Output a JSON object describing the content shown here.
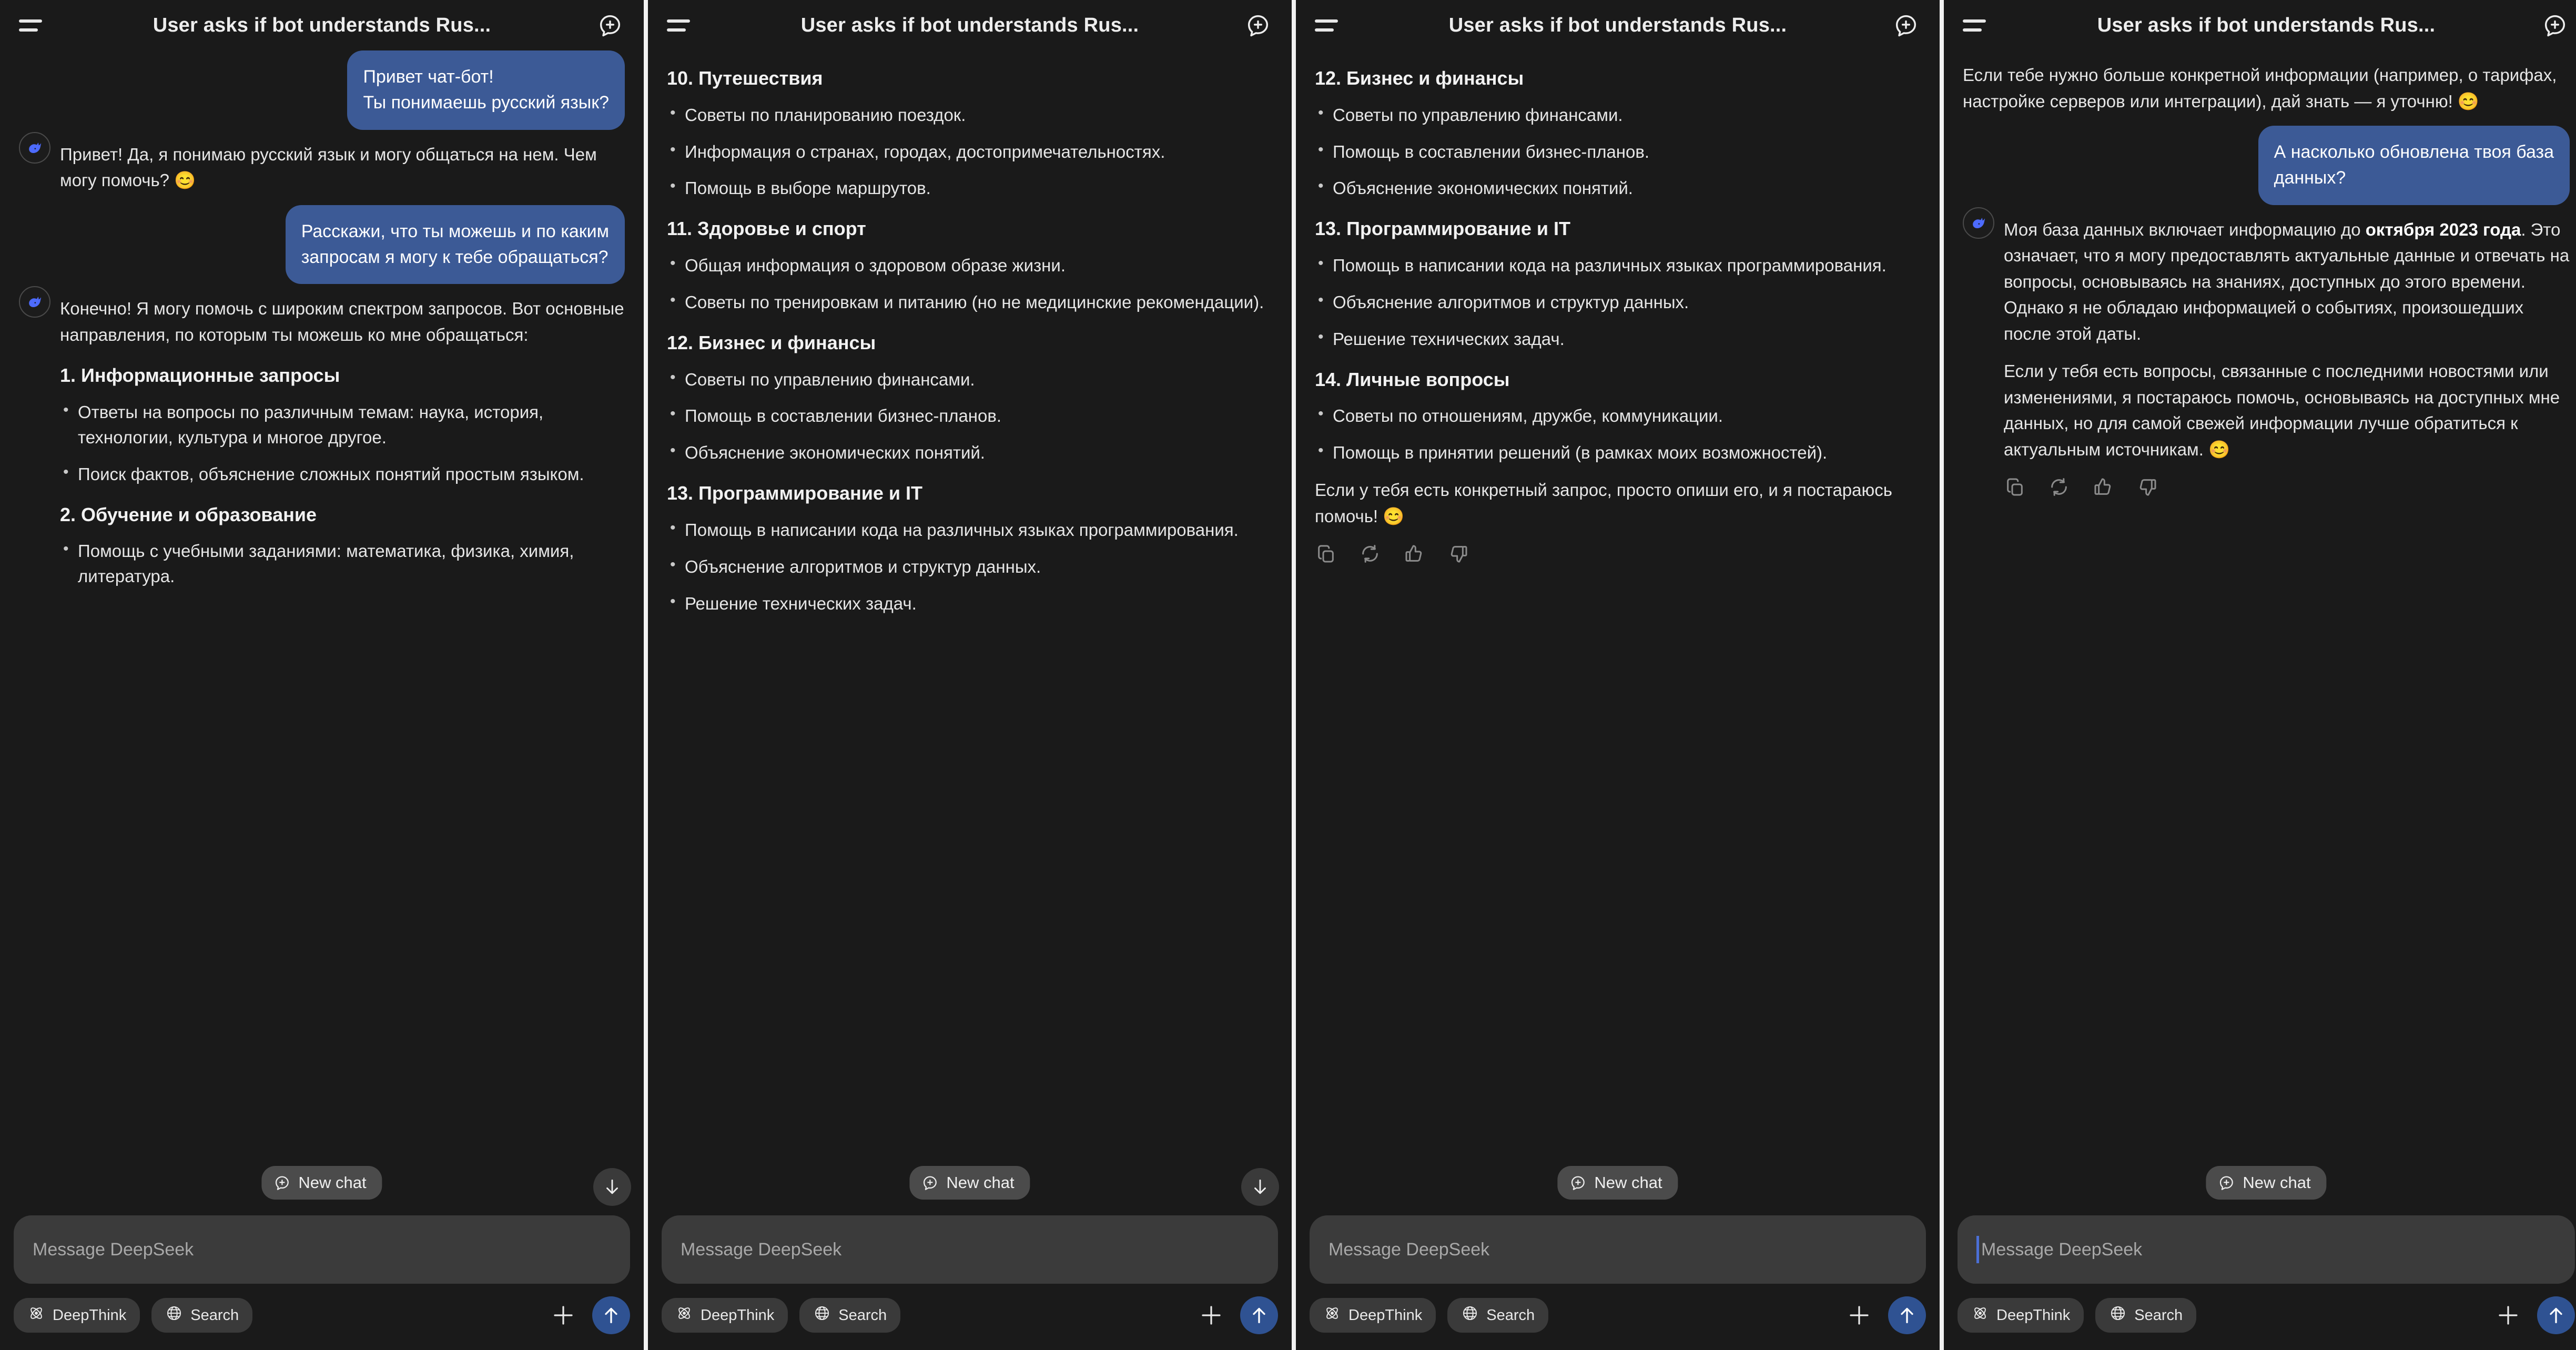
{
  "app": {
    "name": "DeepSeek",
    "accent_blue": "#3c5a96",
    "send_button_blue": "#2f5292",
    "background": "#1a1a1a",
    "bubble_blue": "#3c5a96",
    "divider_color": "#f2f2f2"
  },
  "header": {
    "title": "User asks if bot understands Rus...",
    "menu_icon": "hamburger-icon",
    "new_chat_icon": "new-chat-icon"
  },
  "composer": {
    "placeholder": "Message DeepSeek",
    "deepthink_label": "DeepThink",
    "search_label": "Search",
    "plus_icon": "plus-icon",
    "send_icon": "arrow-up-icon"
  },
  "overlay": {
    "new_chat_label": "New chat",
    "scroll_down_icon": "arrow-down-icon"
  },
  "feedback_icons": [
    "copy-icon",
    "regenerate-icon",
    "thumbs-up-icon",
    "thumbs-down-icon"
  ],
  "panels": [
    {
      "id": "panel-1",
      "input_focused": false,
      "show_float_newchat": true,
      "show_scrolldown": true,
      "messages": [
        {
          "role": "user",
          "lines": [
            "Привет чат-бот!",
            "Ты понимаешь русский язык?"
          ]
        },
        {
          "role": "bot",
          "avatar": true,
          "blocks": [
            {
              "type": "para",
              "text": "Привет! Да, я понимаю русский язык и могу общаться на нем. Чем могу помочь? 😊"
            }
          ]
        },
        {
          "role": "user",
          "lines": [
            "Расскажи, что ты можешь и по каким",
            "запросам я могу к тебе обращаться?"
          ]
        },
        {
          "role": "bot",
          "avatar": true,
          "blocks": [
            {
              "type": "para",
              "text": "Конечно! Я могу помочь с широким спектром запросов. Вот основные направления, по которым ты можешь ко мне обращаться:"
            },
            {
              "type": "heading",
              "text": "1. Информационные запросы"
            },
            {
              "type": "list",
              "items": [
                "Ответы на вопросы по различным темам: наука, история, технологии, культура и многое другое.",
                "Поиск фактов, объяснение сложных понятий простым языком."
              ]
            },
            {
              "type": "heading",
              "text": "2. Обучение и образование"
            },
            {
              "type": "list",
              "items": [
                "Помощь с учебными заданиями: математика, физика, химия, литература."
              ]
            }
          ]
        }
      ]
    },
    {
      "id": "panel-2",
      "input_focused": false,
      "show_float_newchat": true,
      "show_scrolldown": true,
      "messages": [
        {
          "role": "bot",
          "avatar": false,
          "blocks": [
            {
              "type": "heading",
              "text": "10. Путешествия"
            },
            {
              "type": "list",
              "items": [
                "Советы по планированию поездок.",
                "Информация о странах, городах, достопримечательностях.",
                "Помощь в выборе маршрутов."
              ]
            },
            {
              "type": "heading",
              "text": "11. Здоровье и спорт"
            },
            {
              "type": "list",
              "items": [
                "Общая информация о здоровом образе жизни.",
                "Советы по тренировкам и питанию (но не медицинские рекомендации)."
              ]
            },
            {
              "type": "heading",
              "text": "12. Бизнес и финансы"
            },
            {
              "type": "list",
              "items": [
                "Советы по управлению финансами.",
                "Помощь в составлении бизнес-планов.",
                "Объяснение экономических понятий."
              ]
            },
            {
              "type": "heading",
              "text": "13. Программирование и IT"
            },
            {
              "type": "list",
              "items": [
                "Помощь в написании кода на различных языках программирования.",
                "Объяснение алгоритмов и структур данных.",
                "Решение технических задач."
              ]
            }
          ]
        }
      ]
    },
    {
      "id": "panel-3",
      "input_focused": false,
      "show_float_newchat": true,
      "show_scrolldown": false,
      "messages": [
        {
          "role": "bot",
          "avatar": false,
          "blocks": [
            {
              "type": "heading",
              "text": "12. Бизнес и финансы"
            },
            {
              "type": "list",
              "items": [
                "Советы по управлению финансами.",
                "Помощь в составлении бизнес-планов.",
                "Объяснение экономических понятий."
              ]
            },
            {
              "type": "heading",
              "text": "13. Программирование и IT"
            },
            {
              "type": "list",
              "items": [
                "Помощь в написании кода на различных языках программирования.",
                "Объяснение алгоритмов и структур данных.",
                "Решение технических задач."
              ]
            },
            {
              "type": "heading",
              "text": "14. Личные вопросы"
            },
            {
              "type": "list",
              "items": [
                "Советы по отношениям, дружбе, коммуникации.",
                "Помощь в принятии решений (в рамках моих возможностей)."
              ]
            },
            {
              "type": "para",
              "text": "Если у тебя есть конкретный запрос, просто опиши его, и я постараюсь помочь! 😊"
            },
            {
              "type": "feedback"
            }
          ]
        }
      ]
    },
    {
      "id": "panel-4",
      "input_focused": true,
      "show_float_newchat": true,
      "show_scrolldown": false,
      "messages": [
        {
          "role": "bot",
          "avatar": false,
          "blocks": [
            {
              "type": "para",
              "text": "Если тебе нужно больше конкретной информации (например, о тарифах, настройке серверов или интеграции), дай знать — я уточню! 😊"
            }
          ]
        },
        {
          "role": "user",
          "lines": [
            "А насколько обновлена твоя база",
            "данных?"
          ]
        },
        {
          "role": "bot",
          "avatar": true,
          "blocks": [
            {
              "type": "para-bold",
              "pre": "Моя база данных включает информацию до ",
              "bold": "октября 2023 года",
              "post": ". Это означает, что я могу предоставлять актуальные данные и отвечать на вопросы, основываясь на знаниях, доступных до этого времени. Однако я не обладаю информацией о событиях, произошедших после этой даты."
            },
            {
              "type": "para",
              "text": "Если у тебя есть вопросы, связанные с последними новостями или изменениями, я постараюсь помочь, основываясь на доступных мне данных, но для самой свежей информации лучше обратиться к актуальным источникам. 😊"
            },
            {
              "type": "feedback"
            }
          ]
        }
      ]
    }
  ]
}
